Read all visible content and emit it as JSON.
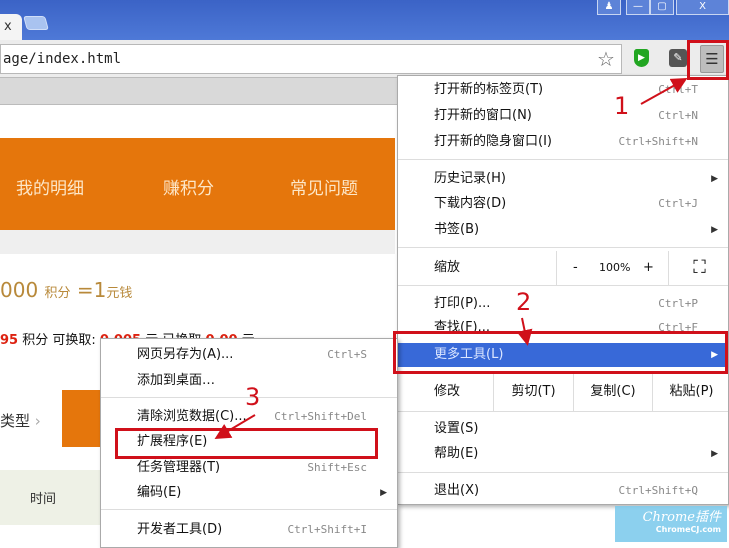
{
  "browser": {
    "tab_close": "x",
    "window_buttons": [
      "♟",
      "—",
      "▢",
      "X"
    ],
    "url": "age/index.html",
    "icons": {
      "bookmark": "star-icon",
      "ext1": "shield-icon",
      "ext2": "extension-icon",
      "menu": "hamburger-icon"
    }
  },
  "page": {
    "nav": [
      "我的明细",
      "赚积分",
      "常见问题"
    ],
    "rate": {
      "value": "000",
      "unit": "积分",
      "eq": "=1",
      "currency": "元钱"
    },
    "earn": {
      "points": "95",
      "points_label": "积分",
      "exchange_label": "可换取:",
      "exchange_value": "0.005",
      "yuan": "元",
      "exchanged_label": "已换取",
      "exchanged_value": "0.00",
      "yuan2": "元"
    },
    "type_label": "类型",
    "time_label": "时间"
  },
  "main_menu": {
    "items": [
      {
        "label": "打开新的标签页(T)",
        "shortcut": "Ctrl+T"
      },
      {
        "label": "打开新的窗口(N)",
        "shortcut": "Ctrl+N"
      },
      {
        "label": "打开新的隐身窗口(I)",
        "shortcut": "Ctrl+Shift+N"
      },
      {
        "label": "历史记录(H)"
      },
      {
        "label": "下载内容(D)",
        "shortcut": "Ctrl+J"
      },
      {
        "label": "书签(B)"
      },
      {
        "label": "打印(P)...",
        "shortcut": "Ctrl+P"
      },
      {
        "label": "查找(F)...",
        "shortcut": "Ctrl+F"
      },
      {
        "label": "更多工具(L)"
      },
      {
        "label": "设置(S)"
      },
      {
        "label": "帮助(E)"
      },
      {
        "label": "退出(X)",
        "shortcut": "Ctrl+Shift+Q"
      }
    ],
    "zoom": {
      "label": "缩放",
      "minus": "-",
      "value": "100%",
      "plus": "+",
      "fullscreen": "⛶"
    },
    "edit": {
      "label": "修改",
      "cut": "剪切(T)",
      "copy": "复制(C)",
      "paste": "粘贴(P)"
    }
  },
  "sub_menu": {
    "items": [
      {
        "label": "网页另存为(A)...",
        "shortcut": "Ctrl+S"
      },
      {
        "label": "添加到桌面…"
      },
      {
        "label": "清除浏览数据(C)...",
        "shortcut": "Ctrl+Shift+Del"
      },
      {
        "label": "扩展程序(E)"
      },
      {
        "label": "任务管理器(T)",
        "shortcut": "Shift+Esc"
      },
      {
        "label": "编码(E)"
      },
      {
        "label": "开发者工具(D)",
        "shortcut": "Ctrl+Shift+I"
      }
    ]
  },
  "annotations": [
    "1",
    "2",
    "3"
  ],
  "watermark": {
    "line1": "Chrome插件",
    "line2": "ChromeCJ.com"
  },
  "colors": {
    "orange": "#e5760c",
    "highlight": "#3869d8",
    "annotation": "#d0101a"
  }
}
